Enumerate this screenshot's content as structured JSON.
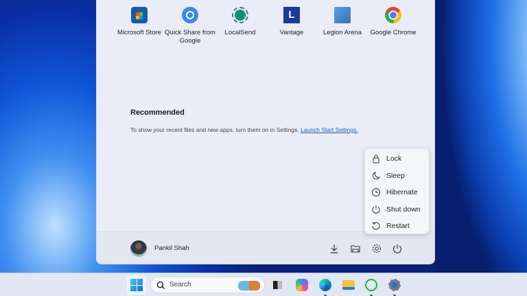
{
  "pinned_apps": [
    {
      "name": "Microsoft Store",
      "icon": "microsoft-store-icon"
    },
    {
      "name": "Quick Share from Google",
      "icon": "quick-share-icon"
    },
    {
      "name": "LocalSend",
      "icon": "localsend-icon"
    },
    {
      "name": "Vantage",
      "icon": "vantage-icon"
    },
    {
      "name": "Legion Arena",
      "icon": "legion-arena-icon"
    },
    {
      "name": "Google Chrome",
      "icon": "chrome-icon"
    }
  ],
  "recommended": {
    "title": "Recommended",
    "text": "To show your recent files and new apps, turn them on in Settings.",
    "link": "Launch Start Settings."
  },
  "user": {
    "name": "Pankil Shah"
  },
  "power_menu": [
    "Lock",
    "Sleep",
    "Hibernate",
    "Shut down",
    "Restart"
  ],
  "taskbar": {
    "search_placeholder": "Search"
  },
  "vantage_letter": "L"
}
